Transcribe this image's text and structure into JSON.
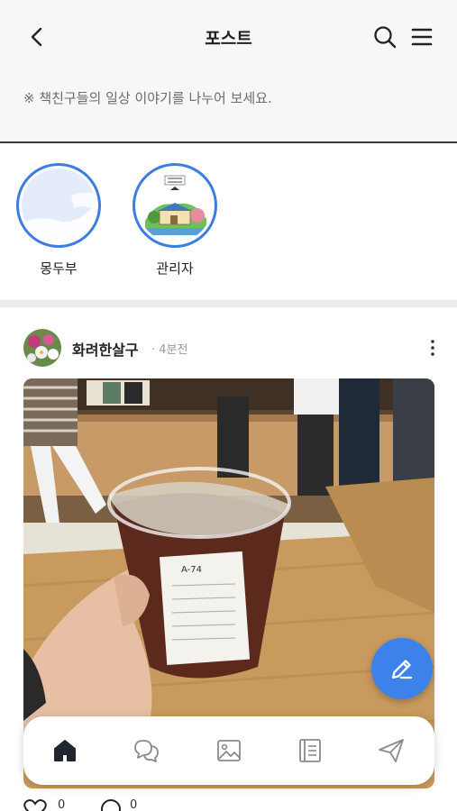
{
  "header": {
    "title": "포스트",
    "back_icon": "chevron-left-icon",
    "search_icon": "search-icon",
    "menu_icon": "hamburger-menu-icon"
  },
  "notice": {
    "text": "※ 책친구들의 일상 이야기를 나누어 보세요."
  },
  "stories": [
    {
      "name": "몽두부"
    },
    {
      "name": "관리자"
    }
  ],
  "post": {
    "author": "화려한살구",
    "time": "· 4분전",
    "more_icon": "more-vertical-icon",
    "like_count": "0",
    "comment_count": "0"
  },
  "fab": {
    "icon": "pencil-icon"
  },
  "bottom_nav": {
    "items": [
      {
        "icon": "home-icon",
        "active": true
      },
      {
        "icon": "chat-bubbles-icon",
        "active": false
      },
      {
        "icon": "image-icon",
        "active": false
      },
      {
        "icon": "book-icon",
        "active": false
      },
      {
        "icon": "send-icon",
        "active": false
      }
    ]
  },
  "colors": {
    "accent": "#3d82ea",
    "ring": "#3b7de0",
    "header_bg": "#f7f7f7"
  }
}
